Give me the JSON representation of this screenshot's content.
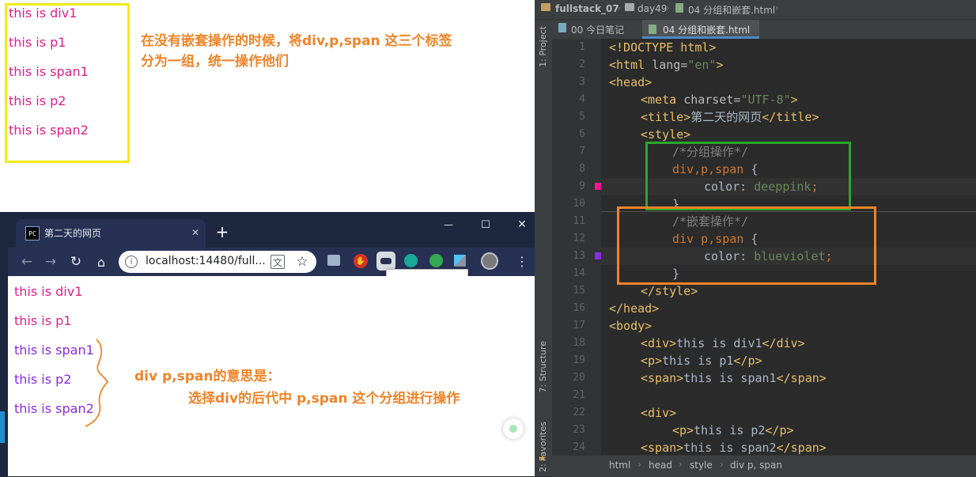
{
  "top_panel": {
    "lines": [
      "this is div1",
      "this is p1",
      "this is span1",
      "this is p2",
      "this is span2"
    ],
    "annotation_line1": "在没有嵌套操作的时候，将div,p,span 这三个标签",
    "annotation_line2": "分为一组，统一操作他们"
  },
  "browser": {
    "tab_title": "第二天的网页",
    "url": "localhost:14480/full...",
    "new_tab_label": "+",
    "window_controls": [
      "—",
      "☐",
      "✕"
    ],
    "content_lines": [
      {
        "text": "this is div1",
        "color": "#e0208a"
      },
      {
        "text": "this is p1",
        "color": "#e0208a"
      },
      {
        "text": "this is span1",
        "color": "#8a2be2"
      },
      {
        "text": "this is p2",
        "color": "#8a2be2"
      },
      {
        "text": "this is span2",
        "color": "#8a2be2"
      }
    ],
    "annotation_line1": "div  p,span的意思是：",
    "annotation_line2": "选择div的后代中 p,span 这个分组进行操作"
  },
  "ide": {
    "breadcrumb": [
      "fullstack_07",
      "day49",
      "04 分组和嵌套.html"
    ],
    "tabs": [
      "00 今日笔记",
      "04 分组和嵌套.html"
    ],
    "left_tool_labels": [
      "1: Project",
      "7: Structure",
      "2: Favorites"
    ],
    "status_breadcrumb": [
      "html",
      "head",
      "style",
      "div p, span"
    ],
    "line_numbers": [
      "1",
      "2",
      "3",
      "4",
      "5",
      "6",
      "7",
      "8",
      "9",
      "10",
      "11",
      "12",
      "13",
      "14",
      "15",
      "16",
      "17",
      "18",
      "19",
      "20",
      "21",
      "22",
      "23",
      "24"
    ],
    "code": {
      "l1": "<!DOCTYPE html>",
      "l2_tag": "<html ",
      "l2_attr": "lang=",
      "l2_val": "\"en\"",
      "l2_end": ">",
      "l3": "<head>",
      "l4_tag": "<meta ",
      "l4_attr": "charset=",
      "l4_val": "\"UTF-8\"",
      "l4_end": ">",
      "l5_open": "<title>",
      "l5_text": "第二天的网页",
      "l5_close": "</title>",
      "l6": "<style>",
      "l7": "/*分组操作*/",
      "l8_sel": "div,p,span",
      "l8_brace": " {",
      "l9_prop": "color: ",
      "l9_val": "deeppink",
      "l9_end": ";",
      "l10": "}",
      "l11": "/*嵌套操作*/",
      "l12_sel": "div p,span",
      "l12_brace": " {",
      "l13_prop": "color: ",
      "l13_val": "blueviolet",
      "l13_end": ";",
      "l14": "}",
      "l15": "</style>",
      "l16": "</head>",
      "l17": "<body>",
      "l18_open": "<div>",
      "l18_text": "this is div1",
      "l18_close": "</div>",
      "l19_open": "<p>",
      "l19_text": "this is p1",
      "l19_close": "</p>",
      "l20_open": "<span>",
      "l20_text": "this is span1",
      "l20_close": "</span>",
      "l21": "",
      "l22": "<div>",
      "l23_open": "<p>",
      "l23_text": "this is p2",
      "l23_close": "</p>",
      "l24_open": "<span>",
      "l24_text": "this is span2",
      "l24_close": "</span>"
    }
  },
  "colors": {
    "deeppink": "#ff1493",
    "blueviolet": "#8a2be2",
    "annotation": "#f08328",
    "highlight_green": "#2aa72a",
    "highlight_orange": "#f08328",
    "yellow_box": "#f2ea17"
  }
}
